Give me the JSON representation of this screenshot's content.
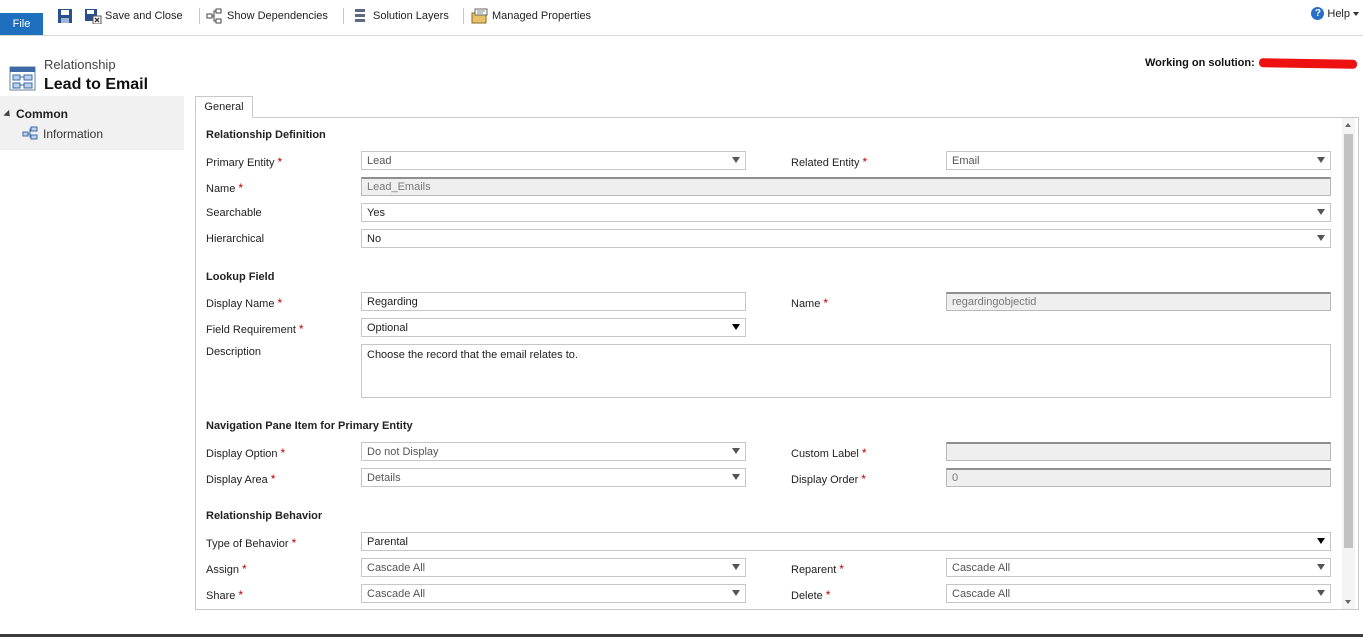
{
  "ribbon": {
    "file": "File",
    "save_and_close": "Save and Close",
    "show_dependencies": "Show Dependencies",
    "solution_layers": "Solution Layers",
    "managed_properties": "Managed Properties",
    "help": "Help"
  },
  "header": {
    "subtitle": "Relationship",
    "title": "Lead to Email",
    "working_on_solution": "Working on solution:"
  },
  "nav": {
    "group": "Common",
    "item": "Information"
  },
  "tabs": {
    "general": "General"
  },
  "relationship_definition": {
    "heading": "Relationship Definition",
    "primary_entity_label": "Primary Entity",
    "primary_entity_value": "Lead",
    "related_entity_label": "Related Entity",
    "related_entity_value": "Email",
    "name_label": "Name",
    "name_value": "Lead_Emails",
    "searchable_label": "Searchable",
    "searchable_value": "Yes",
    "hierarchical_label": "Hierarchical",
    "hierarchical_value": "No"
  },
  "lookup_field": {
    "heading": "Lookup Field",
    "display_name_label": "Display Name",
    "display_name_value": "Regarding",
    "name_label": "Name",
    "name_value": "regardingobjectid",
    "field_requirement_label": "Field Requirement",
    "field_requirement_value": "Optional",
    "description_label": "Description",
    "description_value": "Choose the record that the email relates to."
  },
  "navigation_pane": {
    "heading": "Navigation Pane Item for Primary Entity",
    "display_option_label": "Display Option",
    "display_option_value": "Do not Display",
    "custom_label_label": "Custom Label",
    "custom_label_value": "",
    "display_area_label": "Display Area",
    "display_area_value": "Details",
    "display_order_label": "Display Order",
    "display_order_value": "0"
  },
  "relationship_behavior": {
    "heading": "Relationship Behavior",
    "type_label": "Type of Behavior",
    "type_value": "Parental",
    "assign_label": "Assign",
    "assign_value": "Cascade All",
    "reparent_label": "Reparent",
    "reparent_value": "Cascade All",
    "share_label": "Share",
    "share_value": "Cascade All",
    "delete_label": "Delete",
    "delete_value": "Cascade All"
  },
  "required_marker": "*",
  "colors": {
    "file_button": "#1f6fbf",
    "required": "#c00000",
    "redaction": "#ee1111"
  }
}
